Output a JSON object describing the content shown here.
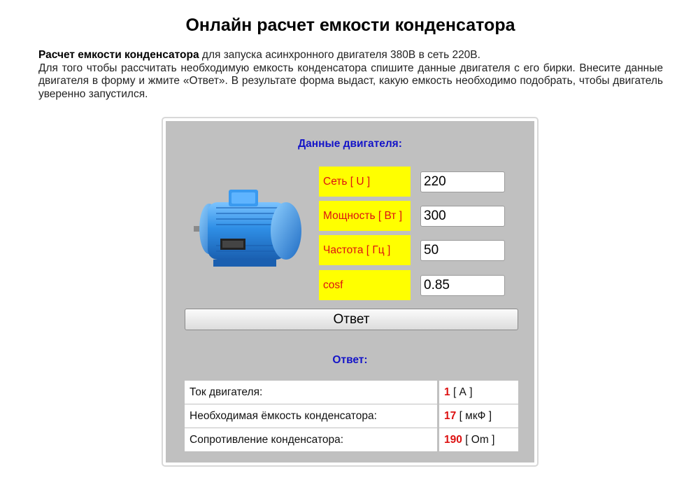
{
  "page": {
    "title": "Онлайн расчет емкости конденсатора",
    "intro_bold": "Расчет емкости конденсатора",
    "intro_rest": " для запуска асинхронного двигателя 380В в сеть 220В.",
    "intro_line2": "Для того чтобы рассчитать необходимую емкость конденсатора спишите данные двигателя с его бирки. Внесите данные двигателя в форму и жмите «Ответ». В результате форма выдаст, какую емкость необходимо подобрать, чтобы двигатель уверенно запустился."
  },
  "form": {
    "heading": "Данные двигателя:",
    "fields": [
      {
        "label": "Сеть [ U ]",
        "value": "220"
      },
      {
        "label": "Мощность [ Вт ]",
        "value": "300"
      },
      {
        "label": "Частота [ Гц ]",
        "value": "50"
      },
      {
        "label": "cosf",
        "value": "0.85"
      }
    ],
    "submit_label": "Ответ"
  },
  "answer": {
    "heading": "Ответ:",
    "rows": [
      {
        "label": "Ток двигателя:",
        "value": "1",
        "unit": "[ А ]"
      },
      {
        "label": "Необходимая ёмкость конденсатора:",
        "value": "17",
        "unit": "[ мкФ ]"
      },
      {
        "label": "Сопротивление конденсатора:",
        "value": "190",
        "unit": "[ Om ]"
      }
    ]
  },
  "colors": {
    "heading_blue": "#1414c8",
    "label_bg": "#ffff00",
    "label_text": "#dd1111",
    "panel_bg": "#c0c0c0",
    "motor_blue": "#2f8fe6"
  },
  "icons": {
    "motor": "electric-motor-image"
  }
}
